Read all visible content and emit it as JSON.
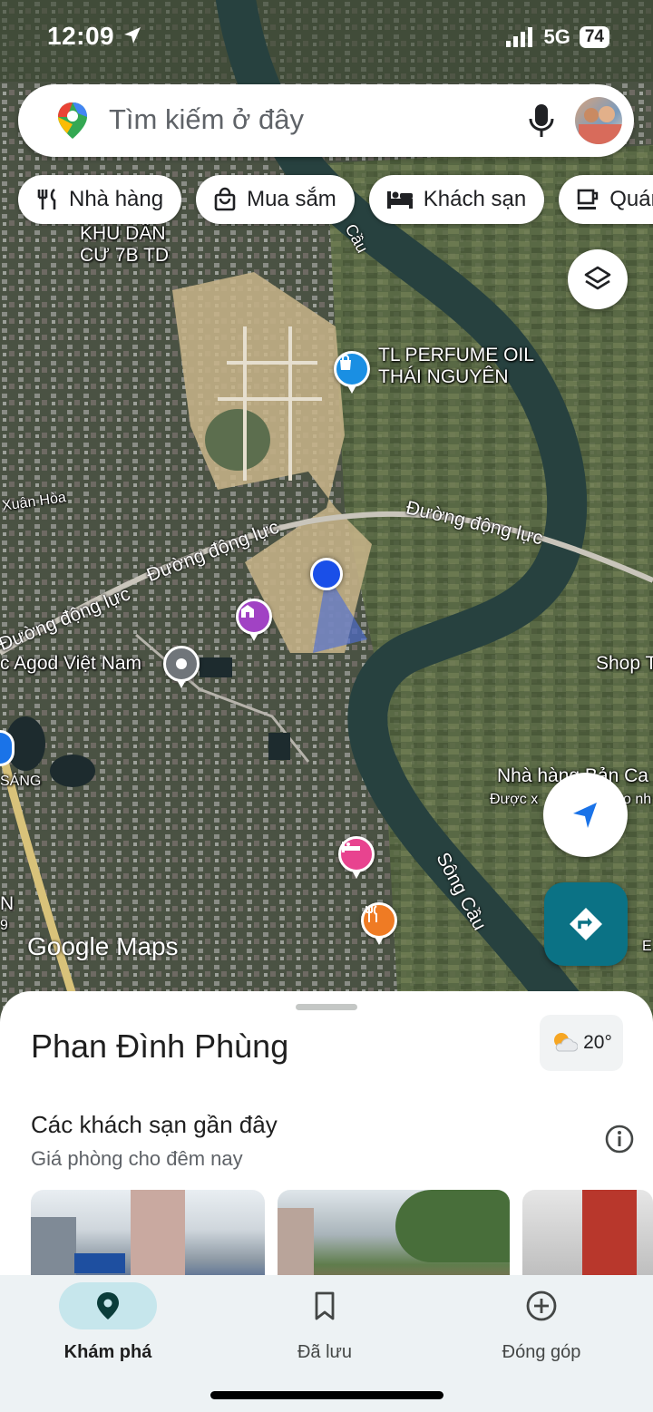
{
  "status_bar": {
    "time": "12:09",
    "network": "5G",
    "battery": "74"
  },
  "search": {
    "placeholder": "Tìm kiếm ở đây"
  },
  "chips": [
    {
      "label": "Nhà hàng",
      "icon": "fork-knife-icon"
    },
    {
      "label": "Mua sắm",
      "icon": "shopping-bag-icon"
    },
    {
      "label": "Khách sạn",
      "icon": "bed-icon"
    },
    {
      "label": "Quán c",
      "icon": "coffee-icon"
    }
  ],
  "map": {
    "labels": {
      "khu_dan_cu_1": "KHU DÂN",
      "khu_dan_cu_2": "CƯ 7B TD",
      "perfume_1": "TL PERFUME OIL",
      "perfume_2": "THÁI NGUYÊN",
      "xuan_hoa": "Xuân Hòa",
      "road_a": "Đường động lực",
      "road_b": "Đường động lực",
      "road_c": "Đường động lực",
      "agod": "c Agod Việt Nam",
      "shop": "Shop T",
      "sang": "SÁNG",
      "nha_hang": "Nhà hàng Bản Ca",
      "duoc_xep": "Được x",
      "duoc_xep_end": "o nh",
      "song_cau": "Sông Cầu",
      "cau": "Cầu",
      "edge_n": "N",
      "edge_9": "9",
      "edge_e": "E"
    },
    "logo": "Google Maps"
  },
  "sheet": {
    "place": "Phan Đình Phùng",
    "temperature": "20°",
    "section_title": "Các khách sạn gần đây",
    "section_sub": "Giá phòng cho đêm nay"
  },
  "nav": [
    {
      "label": "Khám phá",
      "icon": "location-pin-icon",
      "active": true
    },
    {
      "label": "Đã lưu",
      "icon": "bookmark-icon",
      "active": false
    },
    {
      "label": "Đóng góp",
      "icon": "add-circle-icon",
      "active": false
    }
  ],
  "colors": {
    "accent": "#0b7285",
    "location_blue": "#1a73e8",
    "nav_bg": "#edf2f4",
    "active_pill": "#c6e6ec"
  }
}
